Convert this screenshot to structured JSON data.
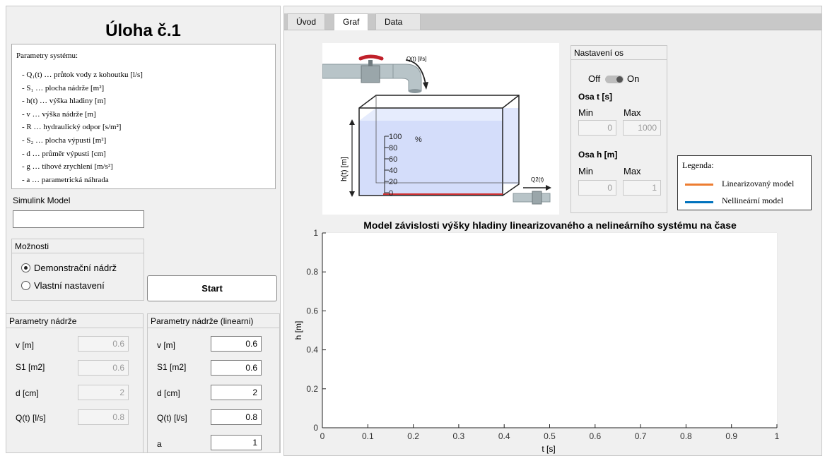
{
  "left": {
    "title": "Úloha č.1",
    "params_header": "Parametry systému:",
    "params": [
      "-  Q₁(t) … průtok vody z kohoutku [l/s]",
      "-  S₁ … plocha nádrže [m²]",
      "-  h(t) … výška hladiny [m]",
      "-  v … výška nádrže [m]",
      "-  R … hydraulický odpor [s/m²]",
      "-  S₂ … plocha výpusti [m²]",
      "-  d … průměr výpusti [cm]",
      "-  g … tíhové zrychlení [m/s²]",
      "-  a … parametrická náhrada"
    ],
    "simulink_label": "Simulink Model",
    "simulink_value": "",
    "options_title": "Možnosti",
    "option_demo": "Demonstrační nádrž",
    "option_custom": "Vlastní nastavení",
    "start_label": "Start",
    "tank_title": "Parametry nádrže",
    "tank_linear_title": "Parametry nádrže (linearni)",
    "tank_labels": [
      "v [m]",
      "S1 [m2]",
      "d [cm]",
      "Q(t) [l/s]"
    ],
    "tank_values": [
      "0.6",
      "0.6",
      "2",
      "0.8"
    ],
    "lin_labels": [
      "v [m]",
      "S1 [m2]",
      "d [cm]",
      "Q(t) [l/s]",
      "a"
    ],
    "lin_values": [
      "0.6",
      "0.6",
      "2",
      "0.8",
      "1"
    ]
  },
  "tabs": [
    "Úvod",
    "Graf",
    "Data"
  ],
  "active_tab": "Graf",
  "diagram": {
    "q_label": "Q(t) [l/s]",
    "q2_label": "Q2(t)",
    "h_label": "h(t) [m]",
    "scale": [
      "100",
      "80",
      "60",
      "40",
      "20",
      "0"
    ],
    "percent": "%"
  },
  "axes_settings": {
    "title": "Nastavení os",
    "off": "Off",
    "on": "On",
    "t_label": "Osa t [s]",
    "h_label": "Osa h [m]",
    "min": "Min",
    "max": "Max",
    "t_min": "0",
    "t_max": "1000",
    "h_min": "0",
    "h_max": "1"
  },
  "legend": {
    "title": "Legenda:",
    "items": [
      "Linearizovaný model",
      "Nellineární model"
    ],
    "colors": [
      "#ed7d31",
      "#0072bd"
    ]
  },
  "chart_data": {
    "type": "line",
    "title": "Model závislosti výšky hladiny linearizovaného a nelineárního systému na čase",
    "xlabel": "t [s]",
    "ylabel": "h [m]",
    "xlim": [
      0,
      1
    ],
    "ylim": [
      0,
      1
    ],
    "xticks": [
      "0",
      "0.1",
      "0.2",
      "0.3",
      "0.4",
      "0.5",
      "0.6",
      "0.7",
      "0.8",
      "0.9",
      "1"
    ],
    "yticks": [
      "0",
      "0.2",
      "0.4",
      "0.6",
      "0.8",
      "1"
    ],
    "grid": true,
    "series": []
  }
}
